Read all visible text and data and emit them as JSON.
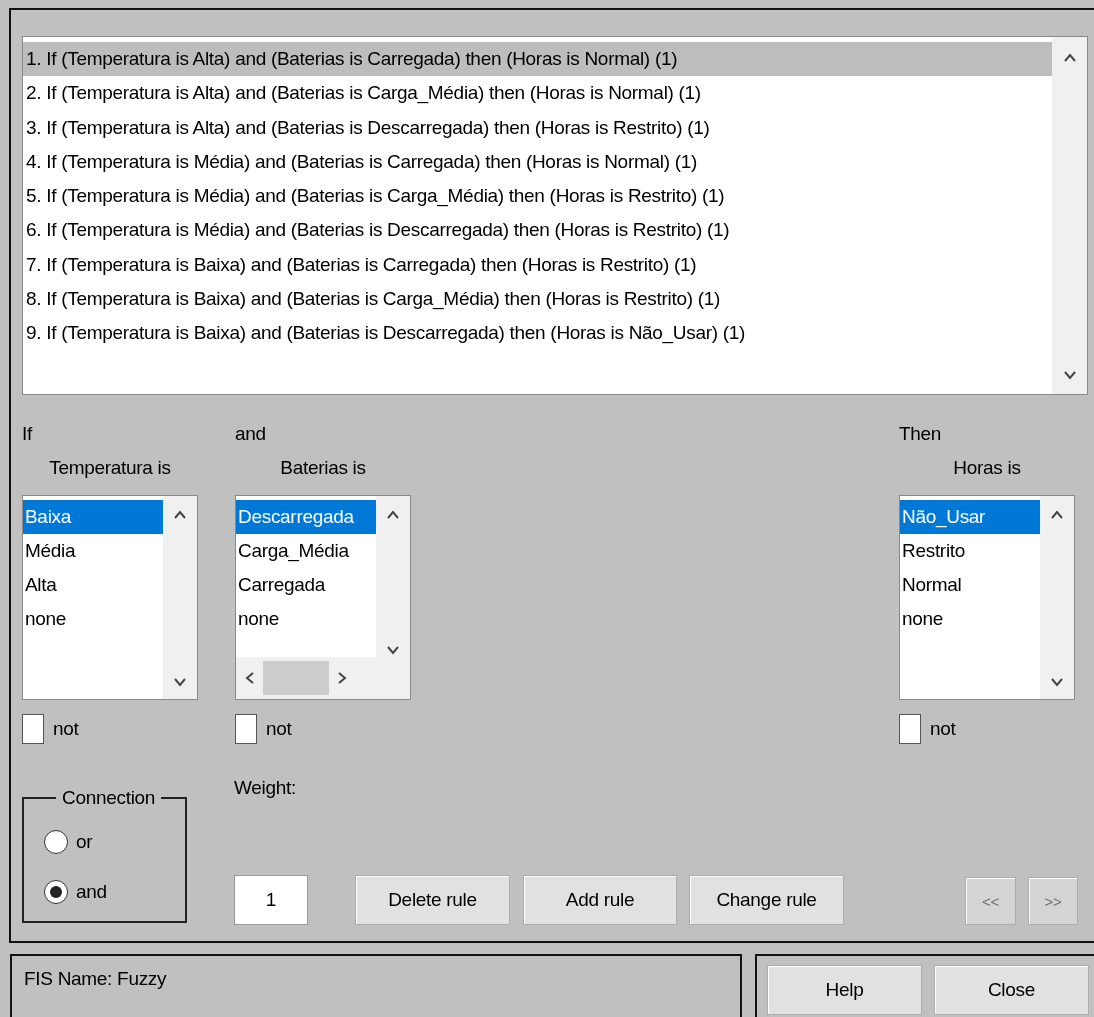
{
  "rules": [
    {
      "text": "1. If (Temperatura is Alta) and (Baterias is Carregada) then (Horas is Normal) (1)",
      "selected": true
    },
    {
      "text": "2. If (Temperatura is Alta) and (Baterias is Carga_Média) then (Horas is Normal) (1)",
      "selected": false
    },
    {
      "text": "3. If (Temperatura is Alta) and (Baterias is Descarregada) then (Horas is Restrito) (1)",
      "selected": false
    },
    {
      "text": "4. If (Temperatura is Média) and (Baterias is Carregada) then (Horas is Normal) (1)",
      "selected": false
    },
    {
      "text": "5. If (Temperatura is Média) and (Baterias is Carga_Média) then (Horas is Restrito) (1)",
      "selected": false
    },
    {
      "text": "6. If (Temperatura is Média) and (Baterias is Descarregada) then (Horas is Restrito) (1)",
      "selected": false
    },
    {
      "text": "7. If (Temperatura is Baixa) and (Baterias is Carregada) then (Horas is Restrito) (1)",
      "selected": false
    },
    {
      "text": "8. If (Temperatura is Baixa) and (Baterias is Carga_Média) then (Horas is Restrito) (1)",
      "selected": false
    },
    {
      "text": "9. If (Temperatura is Baixa) and (Baterias is Descarregada) then (Horas is Não_Usar) (1)",
      "selected": false
    }
  ],
  "variables": [
    {
      "heading": "If",
      "label": "Temperatura is",
      "items": [
        {
          "text": "Baixa",
          "selected": true
        },
        {
          "text": "Média",
          "selected": false
        },
        {
          "text": "Alta",
          "selected": false
        },
        {
          "text": "none",
          "selected": false
        }
      ],
      "horizontal_scrollbar": false,
      "negate": {
        "label": "not",
        "checked": false
      }
    },
    {
      "heading": "and",
      "label": "Baterias is",
      "items": [
        {
          "text": "Descarregada",
          "selected": true
        },
        {
          "text": "Carga_Média",
          "selected": false
        },
        {
          "text": "Carregada",
          "selected": false
        },
        {
          "text": "none",
          "selected": false
        }
      ],
      "horizontal_scrollbar": true,
      "negate": {
        "label": "not",
        "checked": false
      }
    },
    {
      "heading": "Then",
      "label": "Horas is",
      "items": [
        {
          "text": "Não_Usar",
          "selected": true
        },
        {
          "text": "Restrito",
          "selected": false
        },
        {
          "text": "Normal",
          "selected": false
        },
        {
          "text": "none",
          "selected": false
        }
      ],
      "horizontal_scrollbar": false,
      "negate": {
        "label": "not",
        "checked": false
      }
    }
  ],
  "connection": {
    "title": "Connection",
    "options": [
      {
        "label": "or",
        "selected": false
      },
      {
        "label": "and",
        "selected": true
      }
    ]
  },
  "weight": {
    "label": "Weight:",
    "value": "1"
  },
  "buttons": [
    "Delete rule",
    "Add rule",
    "Change rule"
  ],
  "nav": [
    {
      "label": "<<",
      "disabled": true
    },
    {
      "label": ">>",
      "disabled": true
    }
  ],
  "status": "FIS Name: Fuzzy",
  "footer_buttons": [
    "Help",
    "Close"
  ]
}
